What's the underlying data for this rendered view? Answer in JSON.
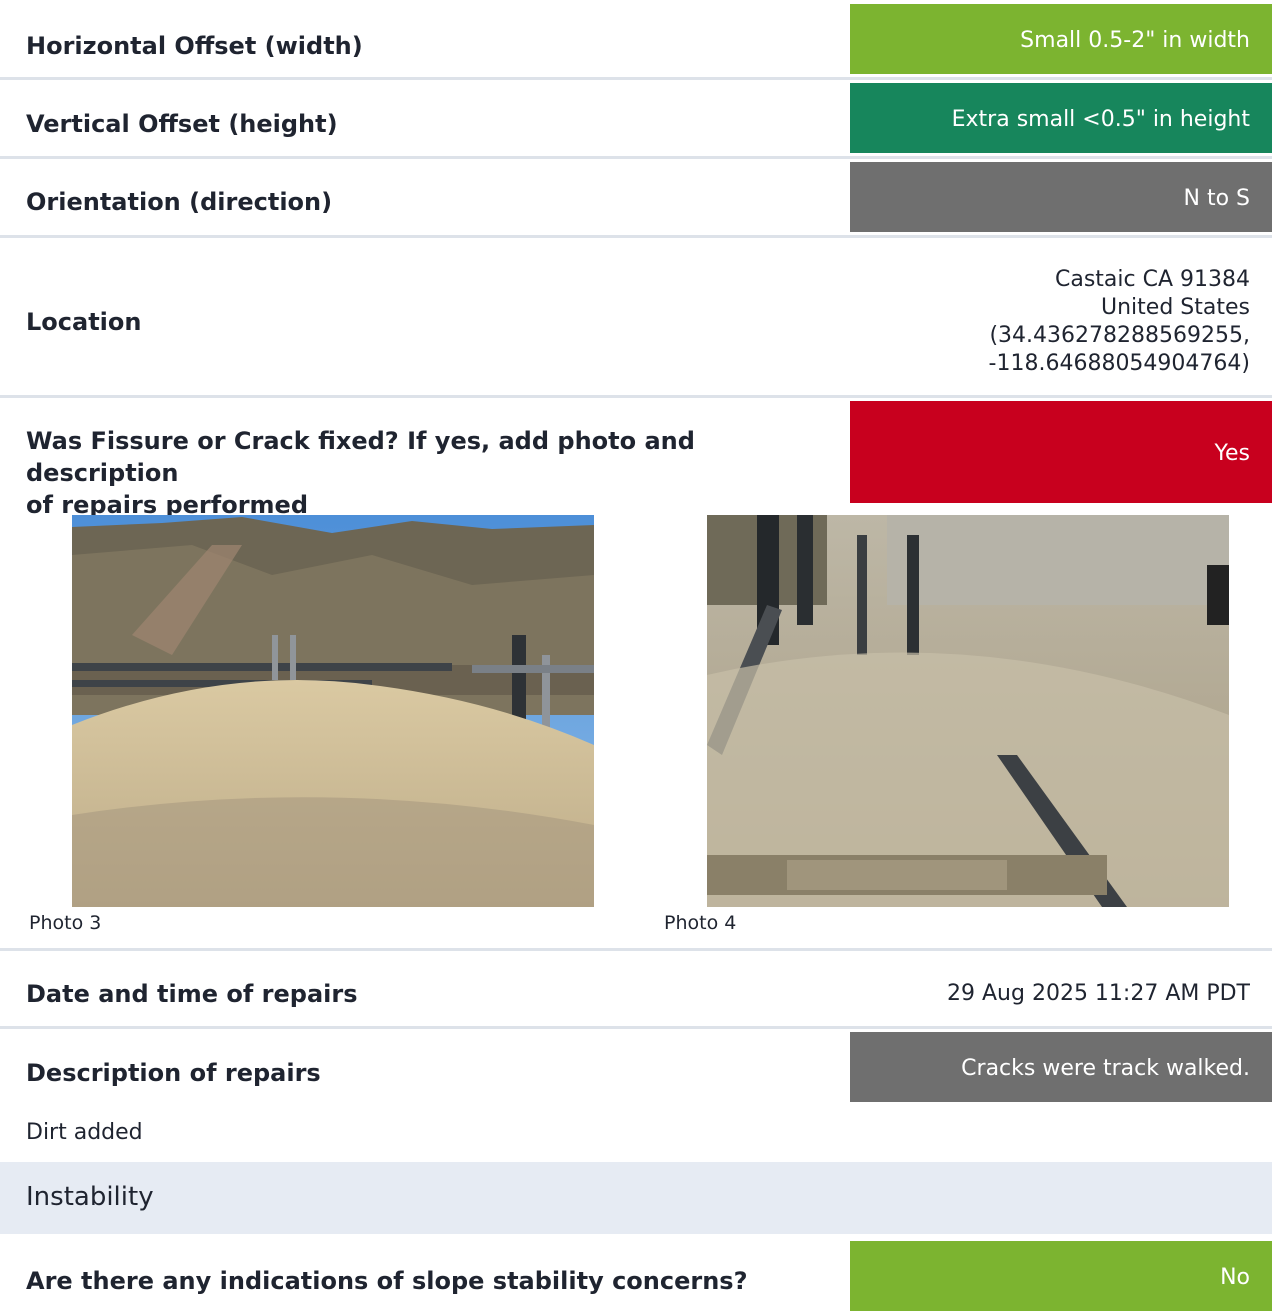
{
  "fields": {
    "horizontal_offset": {
      "label": "Horizontal Offset (width)",
      "value": "Small 0.5-2\" in width",
      "color": "#7cb430"
    },
    "vertical_offset": {
      "label": "Vertical Offset (height)",
      "value": "Extra small <0.5\" in height",
      "color": "#17865c"
    },
    "orientation": {
      "label": "Orientation (direction)",
      "value": "N to S",
      "color": "#6f6f6f"
    },
    "location": {
      "label": "Location",
      "lines": [
        "Castaic CA 91384",
        "United States",
        "(34.436278288569255,",
        "-118.64688054904764)"
      ]
    },
    "fixed": {
      "label_line1": "Was Fissure or Crack fixed? If yes, add photo and description",
      "label_line2": "of repairs performed",
      "value": "Yes",
      "color": "#c8001e"
    },
    "photos": [
      {
        "caption": "Photo 3"
      },
      {
        "caption": "Photo 4"
      }
    ],
    "repair_datetime": {
      "label": "Date and time of repairs",
      "value": "29 Aug 2025 11:27 AM PDT"
    },
    "description": {
      "label": "Description of repairs",
      "value": "Cracks were track walked.",
      "continuation": "Dirt added",
      "color": "#6f6f6f"
    },
    "section_instability": {
      "title": "Instability"
    },
    "slope_concerns": {
      "label": "Are there any indications of slope stability concerns?",
      "value": "No",
      "color": "#7cb430"
    }
  }
}
